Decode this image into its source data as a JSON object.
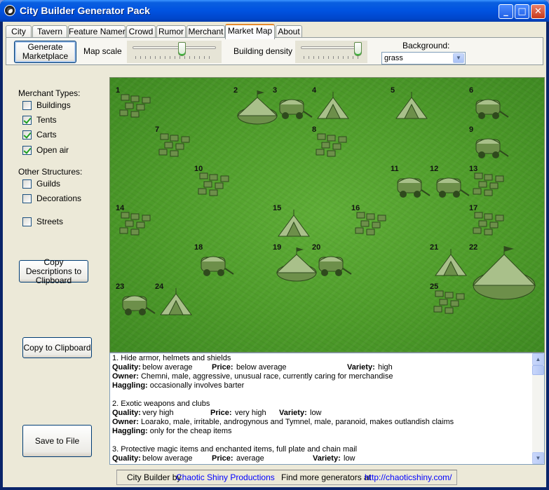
{
  "window": {
    "title": "City Builder Generator Pack",
    "controls": [
      "minimize",
      "maximize",
      "close"
    ]
  },
  "tabs": [
    {
      "label": "City",
      "active": false
    },
    {
      "label": "Tavern",
      "active": false
    },
    {
      "label": "Feature Namer",
      "active": false
    },
    {
      "label": "Crowd",
      "active": false
    },
    {
      "label": "Rumor",
      "active": false
    },
    {
      "label": "Merchant",
      "active": false
    },
    {
      "label": "Market Map",
      "active": true
    },
    {
      "label": "About",
      "active": false
    }
  ],
  "toolbar": {
    "generate_label": "Generate Marketplace",
    "map_scale_label": "Map scale",
    "map_scale_value": 0.6,
    "building_density_label": "Building density",
    "building_density_value": 1.0,
    "background_label": "Background:",
    "background_value": "grass"
  },
  "left_panel": {
    "merchant_types_label": "Merchant Types:",
    "merchant_types": [
      {
        "label": "Buildings",
        "checked": false
      },
      {
        "label": "Tents",
        "checked": true
      },
      {
        "label": "Carts",
        "checked": true
      },
      {
        "label": "Open air",
        "checked": true
      }
    ],
    "other_structures_label": "Other Structures:",
    "other_structures": [
      {
        "label": "Guilds",
        "checked": false
      },
      {
        "label": "Decorations",
        "checked": false
      },
      {
        "label": "Streets",
        "checked": false
      }
    ],
    "copy_descriptions_label": "Copy Descriptions to Clipboard",
    "copy_clipboard_label": "Copy to Clipboard",
    "save_file_label": "Save to File"
  },
  "map": {
    "background_color": "#4e9c2a",
    "markers": [
      {
        "n": "1",
        "kind": "crates"
      },
      {
        "n": "2",
        "kind": "big-tent"
      },
      {
        "n": "3",
        "kind": "cart"
      },
      {
        "n": "4",
        "kind": "tent"
      },
      {
        "n": "5",
        "kind": "tent"
      },
      {
        "n": "6",
        "kind": "cart"
      },
      {
        "n": "7",
        "kind": "crates"
      },
      {
        "n": "8",
        "kind": "crates"
      },
      {
        "n": "9",
        "kind": "cart"
      },
      {
        "n": "10",
        "kind": "crates"
      },
      {
        "n": "11",
        "kind": "cart"
      },
      {
        "n": "12",
        "kind": "cart"
      },
      {
        "n": "13",
        "kind": "crates"
      },
      {
        "n": "14",
        "kind": "crates"
      },
      {
        "n": "15",
        "kind": "tent"
      },
      {
        "n": "16",
        "kind": "crates"
      },
      {
        "n": "17",
        "kind": "crates"
      },
      {
        "n": "18",
        "kind": "cart"
      },
      {
        "n": "19",
        "kind": "big-tent"
      },
      {
        "n": "20",
        "kind": "cart"
      },
      {
        "n": "21",
        "kind": "tent"
      },
      {
        "n": "22",
        "kind": "pavilion"
      },
      {
        "n": "23",
        "kind": "cart"
      },
      {
        "n": "24",
        "kind": "tent"
      },
      {
        "n": "25",
        "kind": "crates"
      }
    ]
  },
  "descriptions": [
    {
      "title": "1. Hide armor, helmets and shields",
      "quality_label": "Quality:",
      "quality": "below average",
      "price_label": "Price:",
      "price": "below average",
      "variety_label": "Variety:",
      "variety": "high",
      "owner_label": "Owner:",
      "owner": "Chemni, male, aggressive, unusual race, currently caring for merchandise",
      "haggling_label": "Haggling:",
      "haggling": "occasionally involves barter"
    },
    {
      "title": "2. Exotic weapons and clubs",
      "quality_label": "Quality:",
      "quality": "very high",
      "price_label": "Price:",
      "price": "very high",
      "variety_label": "Variety:",
      "variety": "low",
      "owner_label": "Owner:",
      "owner": "Loarako, male, irritable, androgynous and Tymnel, male, paranoid, makes outlandish claims",
      "haggling_label": "Haggling:",
      "haggling": "only for the cheap items"
    },
    {
      "title": "3. Protective magic items and enchanted items, full plate and chain mail",
      "quality_label": "Quality:",
      "quality": "below average",
      "price_label": "Price:",
      "price": "average",
      "variety_label": "Variety:",
      "variety": "low"
    }
  ],
  "status_bar": {
    "prefix": "City Builder by",
    "credit_link": "Chaotic Shiny Productions",
    "find_more": "Find more generators at",
    "url": "http://chaoticshiny.com/"
  }
}
